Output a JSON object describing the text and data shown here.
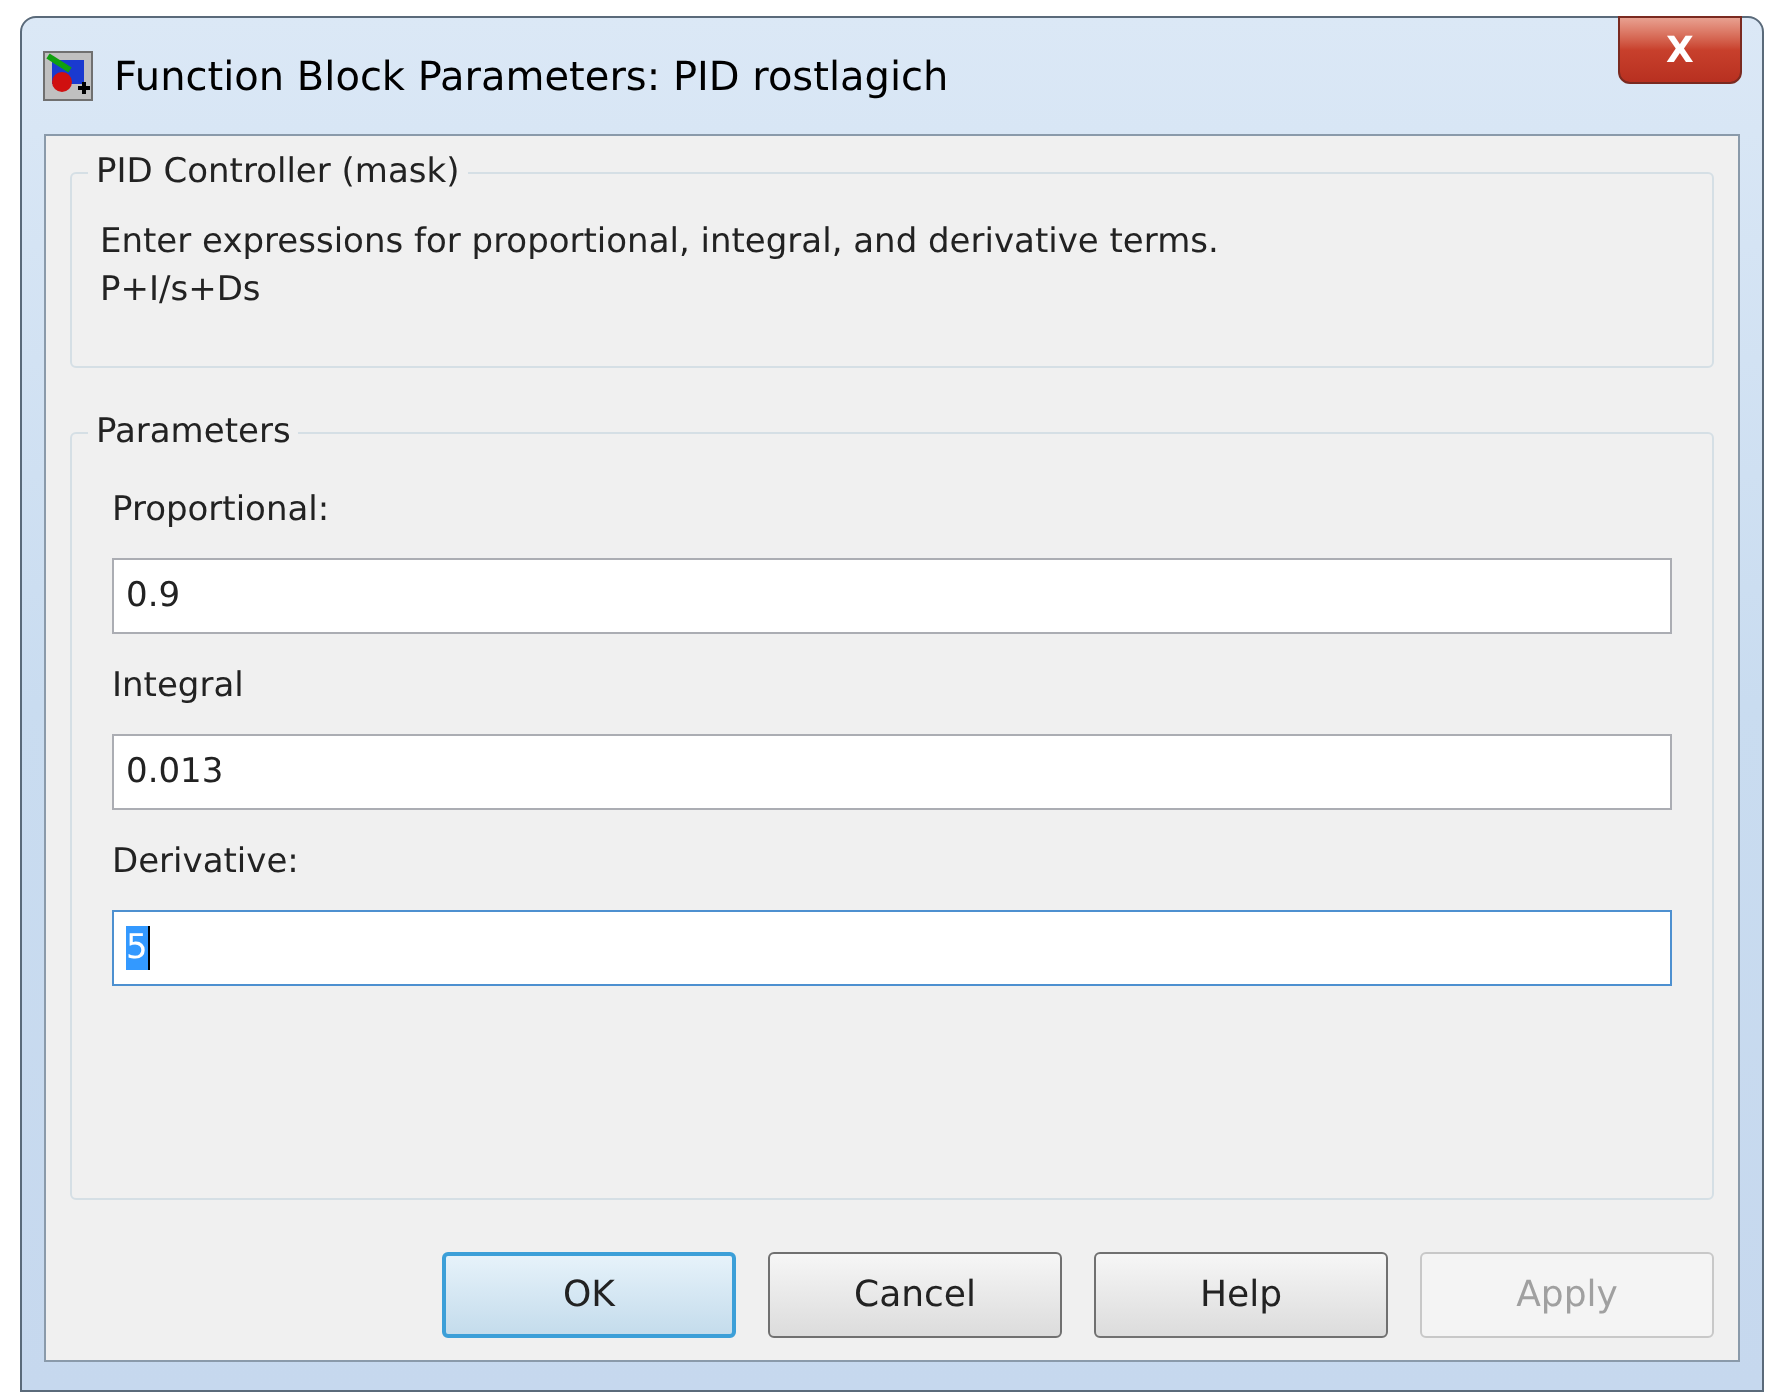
{
  "window": {
    "title": "Function Block Parameters: PID rostlagich",
    "close_label": "X"
  },
  "mask_group": {
    "title": "PID Controller (mask)",
    "description": "Enter expressions for proportional, integral, and derivative terms.",
    "formula": "P+I/s+Ds"
  },
  "parameters_group": {
    "title": "Parameters",
    "fields": [
      {
        "label": "Proportional:",
        "value": "0.9",
        "focused": false
      },
      {
        "label": "Integral",
        "value": "0.013",
        "focused": false
      },
      {
        "label": "Derivative:",
        "value": "5",
        "focused": true
      }
    ]
  },
  "buttons": [
    {
      "label": "OK",
      "default": true,
      "disabled": false
    },
    {
      "label": "Cancel",
      "default": false,
      "disabled": false
    },
    {
      "label": "Help",
      "default": false,
      "disabled": false
    },
    {
      "label": "Apply",
      "default": false,
      "disabled": true
    }
  ]
}
